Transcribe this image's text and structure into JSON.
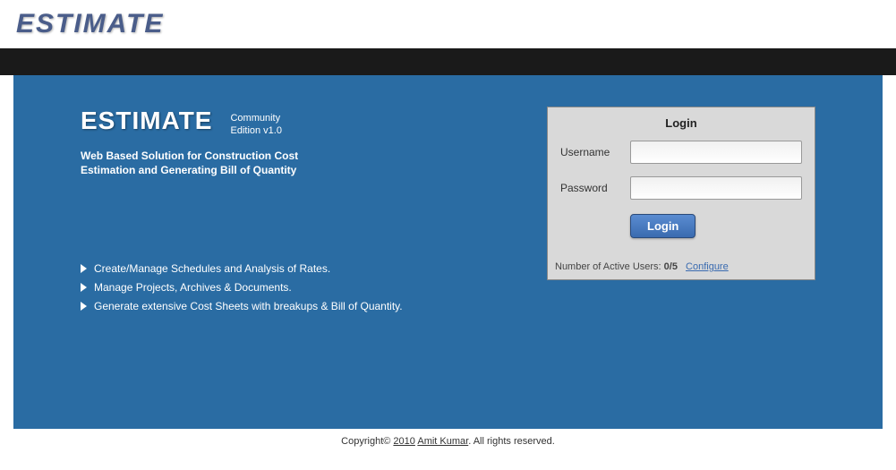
{
  "header": {
    "logo": "ESTIMATE"
  },
  "hero": {
    "brand": "ESTIMATE",
    "edition_line1": "Community",
    "edition_line2": "Edition v1.0",
    "tagline_line1": "Web Based Solution for Construction Cost",
    "tagline_line2": "Estimation and Generating Bill of Quantity"
  },
  "features": {
    "items": [
      "Create/Manage Schedules and Analysis of Rates.",
      "Manage Projects, Archives & Documents.",
      "Generate extensive Cost Sheets with breakups & Bill of Quantity."
    ]
  },
  "login": {
    "title": "Login",
    "username_label": "Username",
    "password_label": "Password",
    "username_value": "",
    "password_value": "",
    "button": "Login",
    "active_users_prefix": "Number of Active Users: ",
    "active_users_value": "0/5",
    "configure": "Configure"
  },
  "footer": {
    "copyright": "Copyright© ",
    "year": "2010",
    "author": "Amit Kumar",
    "suffix": ". All rights reserved."
  }
}
